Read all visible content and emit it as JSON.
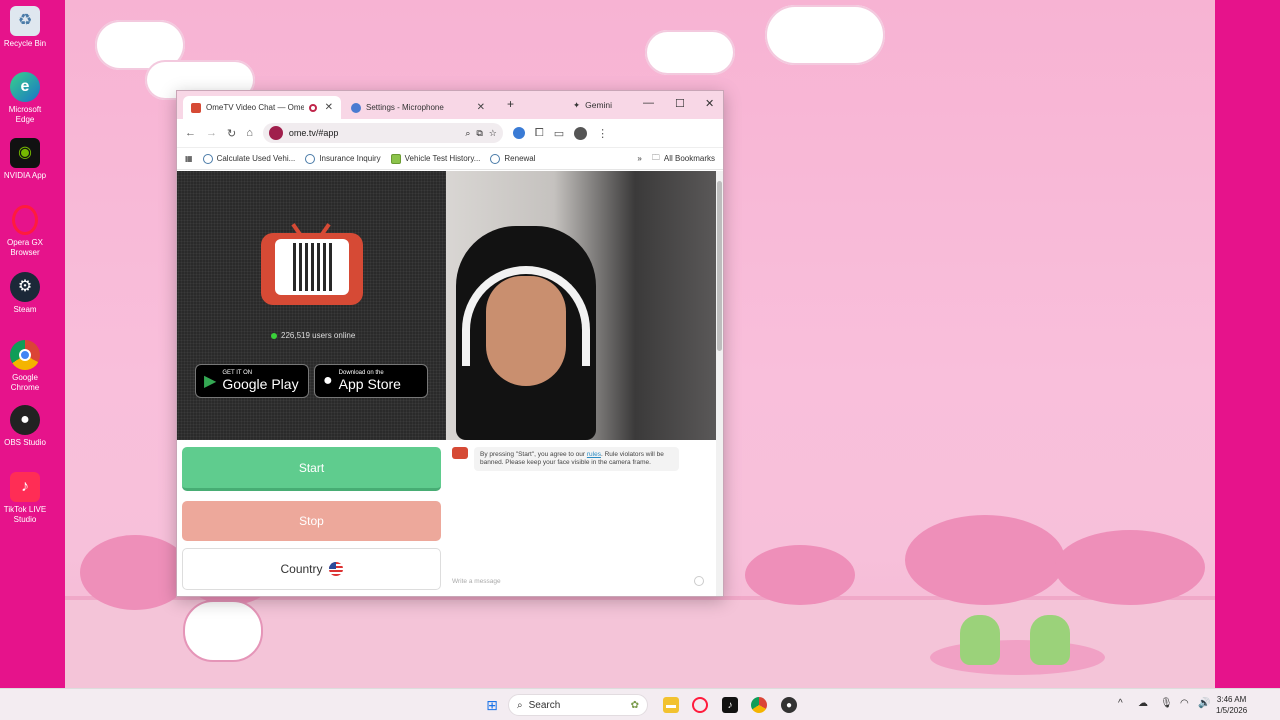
{
  "desktop": {
    "icons": [
      {
        "label": "Recycle Bin",
        "icon": "recycle-bin-icon"
      },
      {
        "label": "Microsoft Edge",
        "icon": "edge-icon"
      },
      {
        "label": "NVIDIA App",
        "icon": "nvidia-icon"
      },
      {
        "label": "Opera GX Browser",
        "icon": "opera-gx-icon"
      },
      {
        "label": "Steam",
        "icon": "steam-icon"
      },
      {
        "label": "Google Chrome",
        "icon": "chrome-icon"
      },
      {
        "label": "OBS Studio",
        "icon": "obs-icon"
      },
      {
        "label": "TikTok LIVE Studio",
        "icon": "tiktok-live-icon"
      }
    ]
  },
  "browser": {
    "tabs": [
      {
        "label": "OmeTV Video Chat — Ome",
        "active": true
      },
      {
        "label": "Settings - Microphone",
        "active": false
      }
    ],
    "new_tab": "+",
    "gemini_label": "Gemini",
    "url": "ome.tv/#app",
    "bookmarks": [
      {
        "label": "Calculate Used Vehi..."
      },
      {
        "label": "Insurance Inquiry"
      },
      {
        "label": "Vehicle Test History..."
      },
      {
        "label": "Renewal"
      }
    ],
    "all_bookmarks": "All Bookmarks",
    "more_bookmarks": "»"
  },
  "page": {
    "users_online": "226,519 users online",
    "google_play": {
      "small": "GET IT ON",
      "big": "Google Play"
    },
    "app_store": {
      "small": "Download on the",
      "big": "App Store"
    },
    "start_label": "Start",
    "stop_label": "Stop",
    "country_label": "Country",
    "chat_notice_before": "By pressing \"Start\", you agree to our ",
    "chat_notice_link": "rules",
    "chat_notice_after": ". Rule violators will be banned. Please keep your face visible in the camera frame.",
    "message_placeholder": "Write a message"
  },
  "taskbar": {
    "search_label": "Search",
    "time": "3:46 AM",
    "date": "1/5/2026"
  },
  "colors": {
    "start": "#5fcc8e",
    "stop": "#eda89b",
    "wallpaper_side": "#e6138b",
    "wallpaper_main": "#f7b3d3"
  }
}
